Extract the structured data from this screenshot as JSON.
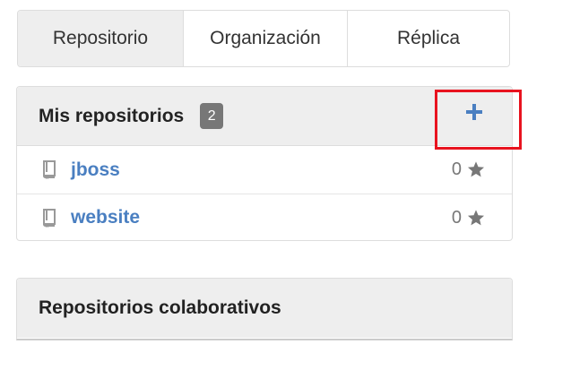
{
  "tabs": [
    {
      "label": "Repositorio",
      "active": true
    },
    {
      "label": "Organización",
      "active": false
    },
    {
      "label": "Réplica",
      "active": false
    }
  ],
  "my_repos": {
    "title": "Mis repositorios",
    "count": "2",
    "add_icon": "plus-icon",
    "items": [
      {
        "name": "jboss",
        "stars": "0"
      },
      {
        "name": "website",
        "stars": "0"
      }
    ]
  },
  "collab_repos": {
    "title": "Repositorios colaborativos"
  },
  "colors": {
    "link": "#4a7fc1",
    "badge": "#777777",
    "highlight": "#e8131f",
    "panel_heading": "#eeeeee"
  }
}
